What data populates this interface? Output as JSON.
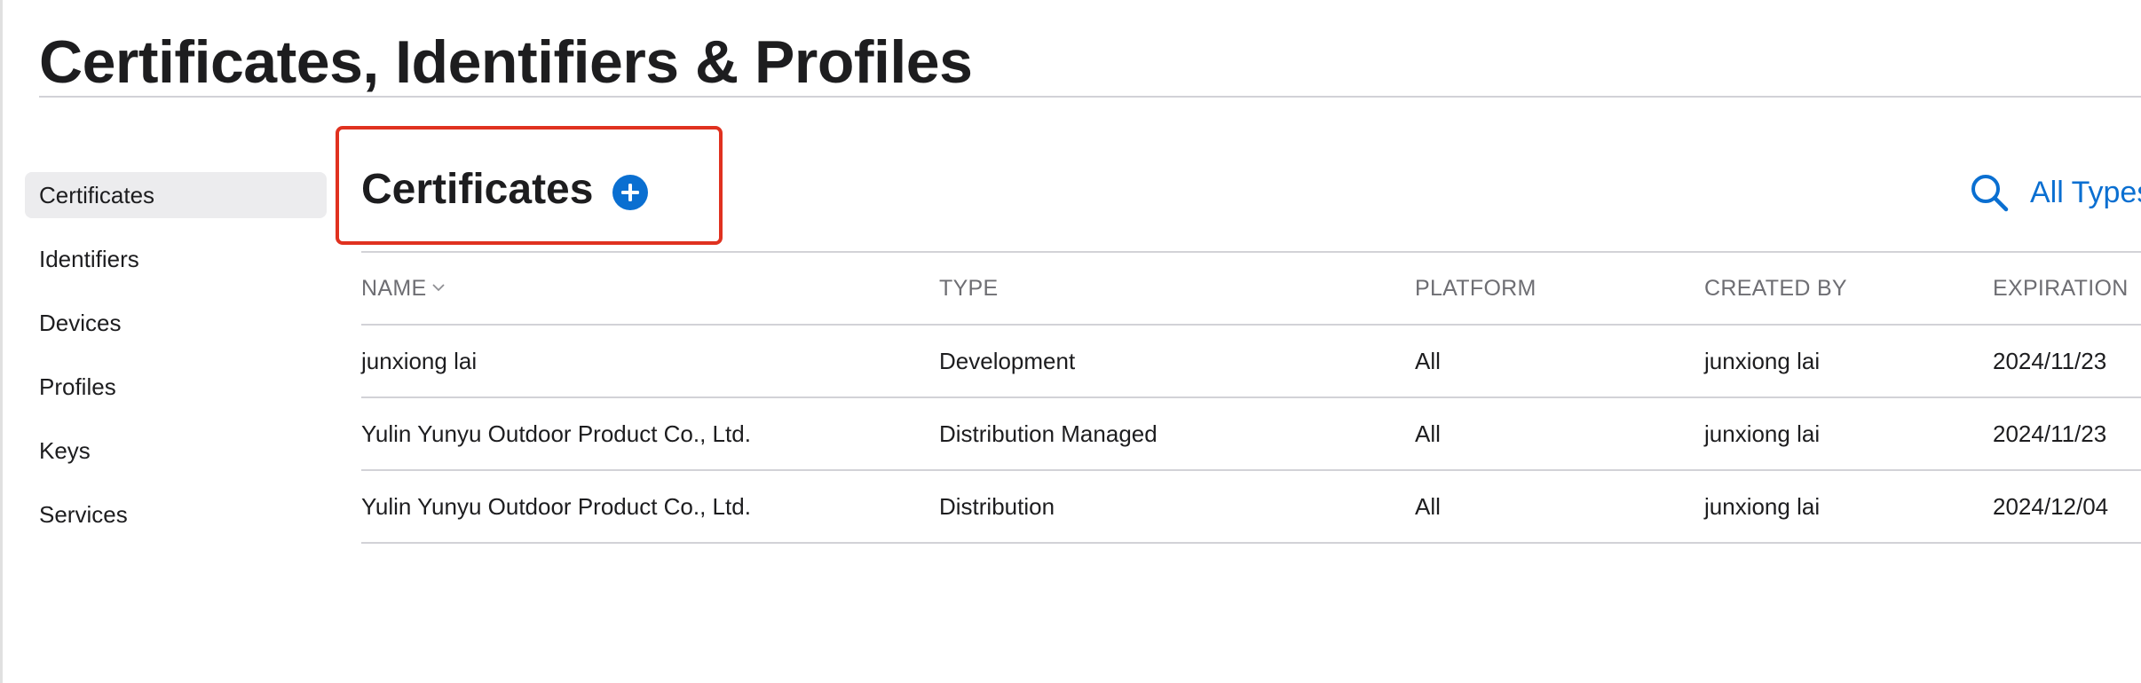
{
  "page": {
    "title": "Certificates, Identifiers & Profiles"
  },
  "sidebar": {
    "items": [
      {
        "label": "Certificates",
        "active": true
      },
      {
        "label": "Identifiers"
      },
      {
        "label": "Devices"
      },
      {
        "label": "Profiles"
      },
      {
        "label": "Keys"
      },
      {
        "label": "Services"
      }
    ]
  },
  "section": {
    "title": "Certificates",
    "add_icon": "plus-circle-icon",
    "search_icon": "search-icon",
    "filter_label": "All Types"
  },
  "table": {
    "columns": [
      "NAME",
      "TYPE",
      "PLATFORM",
      "CREATED BY",
      "EXPIRATION"
    ],
    "sort_icon": "chevron-down-icon",
    "rows": [
      {
        "name": "junxiong lai",
        "type": "Development",
        "platform": "All",
        "created_by": "junxiong lai",
        "expiration": "2024/11/23"
      },
      {
        "name": "Yulin Yunyu Outdoor Product Co., Ltd.",
        "type": "Distribution Managed",
        "platform": "All",
        "created_by": "junxiong lai",
        "expiration": "2024/11/23"
      },
      {
        "name": "Yulin Yunyu Outdoor Product Co., Ltd.",
        "type": "Distribution",
        "platform": "All",
        "created_by": "junxiong lai",
        "expiration": "2024/12/04"
      }
    ]
  },
  "colors": {
    "accent": "#0a6fd1",
    "highlight_border": "#e0311f",
    "text": "#1d1d1f",
    "muted_text": "#6e6e73",
    "divider": "#d2d2d7",
    "active_bg": "#ececee"
  }
}
